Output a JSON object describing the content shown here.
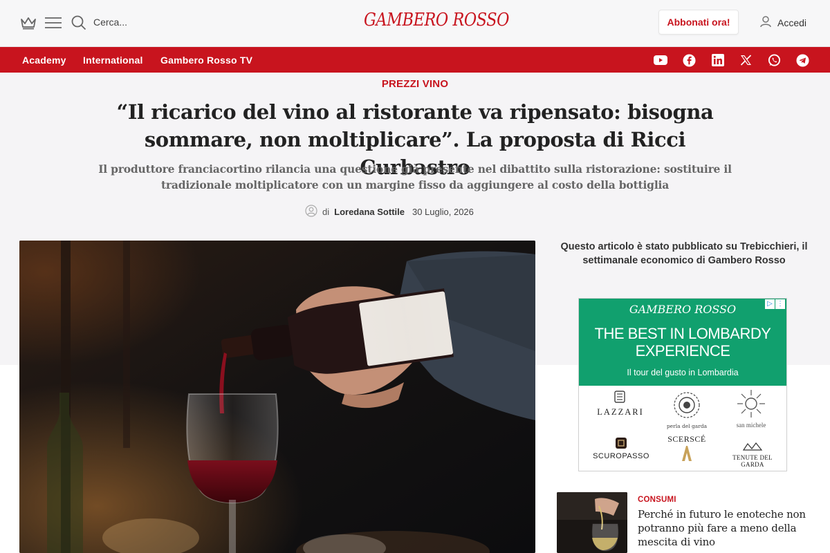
{
  "header": {
    "search_placeholder": "Cerca...",
    "logo_text": "GAMBERO ROSSO",
    "subscribe_label": "Abbonati ora!",
    "login_label": "Accedi"
  },
  "nav": {
    "items": [
      "Academy",
      "International",
      "Gambero Rosso TV"
    ],
    "social_icons": [
      "youtube-icon",
      "facebook-icon",
      "linkedin-icon",
      "x-icon",
      "whatsapp-icon",
      "telegram-icon"
    ]
  },
  "article": {
    "category": "PREZZI VINO",
    "title": "“Il ricarico del vino al ristorante va ripensato: bisogna sommare, non moltiplicare”. La proposta di Ricci Curbastro",
    "subtitle": "Il produttore franciacortino rilancia una questione già presente nel dibattito sulla ristorazione: sostituire il tradizionale moltiplicatore con un margine fisso da aggiungere al costo della bottiglia",
    "byline_prefix": "di",
    "author": "Loredana Sottile",
    "date": "30 Luglio, 2026"
  },
  "sidebar": {
    "note": "Questo articolo è stato pubblicato su Trebicchieri, il settimanale economico di Gambero Rosso",
    "ad": {
      "logo": "GAMBERO ROSSO",
      "title": "THE BEST IN LOMBARDY EXPERIENCE",
      "subtitle": "Il tour del gusto in Lombardia",
      "brands": [
        "LAZZARI",
        "perla del garda",
        "san michele",
        "SCUROPASSO",
        "SCERSCÉ",
        "TENUTE DEL GARDA"
      ]
    },
    "related": {
      "category": "CONSUMI",
      "title": "Perché in futuro le enoteche non potranno più fare a meno della mescita di vino"
    }
  },
  "colors": {
    "brand_red": "#c8141e",
    "ad_green": "#11a06e"
  }
}
